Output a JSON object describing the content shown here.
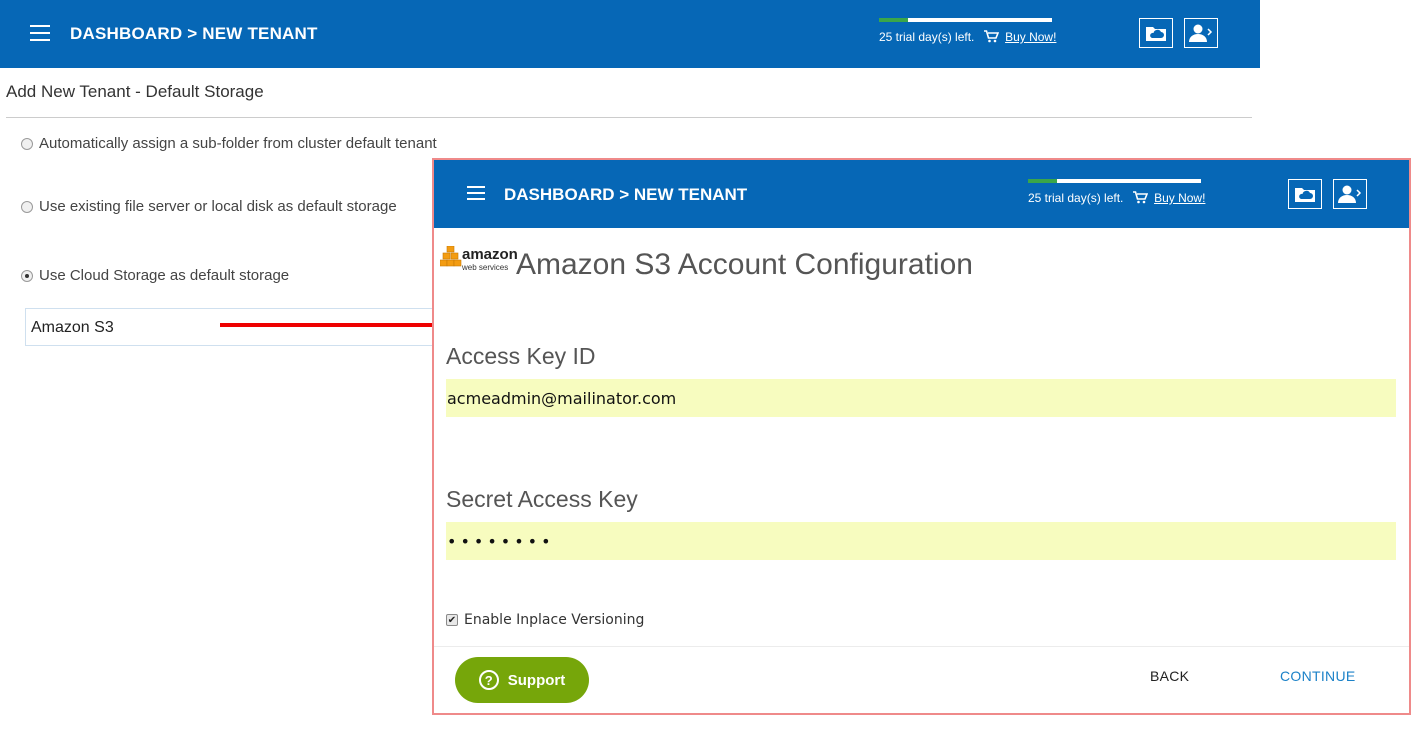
{
  "header": {
    "breadcrumb": "DASHBOARD > NEW TENANT",
    "trial_text": "25 trial day(s) left.",
    "buy_now": "Buy Now!",
    "trial_progress_fraction": 0.17
  },
  "page": {
    "title": "Add New Tenant - Default Storage",
    "options": [
      {
        "label": "Automatically assign a sub-folder from cluster default tenant",
        "selected": false
      },
      {
        "label": "Use existing file server or local disk as default storage",
        "selected": false
      },
      {
        "label": "Use Cloud Storage as default storage",
        "selected": true
      }
    ],
    "storage_select_value": "Amazon S3"
  },
  "dialog": {
    "breadcrumb": "DASHBOARD > NEW TENANT",
    "trial_text": "25 trial day(s) left.",
    "buy_now": "Buy Now!",
    "logo_word": "amazon",
    "logo_sub": "web services",
    "title": "Amazon S3 Account Configuration",
    "access_key_label": "Access Key ID",
    "access_key_value": "acmeadmin@mailinator.com",
    "secret_key_label": "Secret Access Key",
    "secret_key_value": "••••••••",
    "versioning_label": "Enable Inplace Versioning",
    "versioning_checked": true,
    "support_label": "Support",
    "back_label": "BACK",
    "continue_label": "CONTINUE"
  },
  "colors": {
    "header_blue": "#0667b6",
    "progress_green": "#3aa64a",
    "input_yellow": "#f7fcbf",
    "support_green": "#76a60a",
    "continue_blue": "#1c82c8",
    "highlight_border": "#ef8a8a",
    "arrow_red": "#ee0000"
  },
  "icons": [
    "menu-icon",
    "cart-icon",
    "cloud-folder-icon",
    "user-logout-icon",
    "help-circle-icon",
    "amazon-logo-icon"
  ]
}
